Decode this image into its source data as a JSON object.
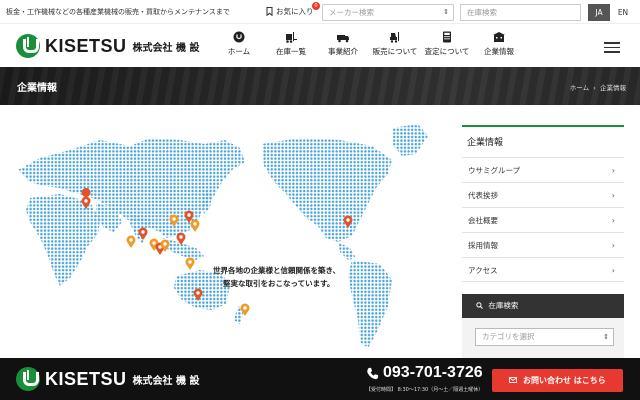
{
  "topbar": {
    "tagline": "板金・工作機械などの各種産業機械の販売・買取からメンテナンスまで",
    "favorites_label": "お気に入り",
    "favorites_count": "0",
    "maker_placeholder": "メーカー検索",
    "stock_placeholder": "在庫検索",
    "lang_ja": "JA",
    "lang_en": "EN"
  },
  "brand": {
    "name": "KISETSU",
    "sub": "株式会社 機 設",
    "color": "#1a8f3a"
  },
  "nav": [
    {
      "label": "ホーム",
      "icon": "home-logo-icon"
    },
    {
      "label": "在庫一覧",
      "icon": "forklift-icon"
    },
    {
      "label": "事業紹介",
      "icon": "truck-icon"
    },
    {
      "label": "販売について",
      "icon": "forklift-sale-icon"
    },
    {
      "label": "査定について",
      "icon": "calculator-icon"
    },
    {
      "label": "企業情報",
      "icon": "building-icon"
    }
  ],
  "banner": {
    "title": "企業情報",
    "breadcrumb_home": "ホーム",
    "breadcrumb_sep": "›",
    "breadcrumb_current": "企業情報"
  },
  "map": {
    "caption_line1": "世界各地の企業様と信頼関係を築き、",
    "caption_line2": "堅実な取引をおこなっています。",
    "dot_color": "#4aa3d8",
    "pin_red": "#e0542a",
    "pin_orange": "#f09a28"
  },
  "sidebar": {
    "title": "企業情報",
    "items": [
      {
        "label": "ウサミグループ"
      },
      {
        "label": "代表挨拶"
      },
      {
        "label": "会社概要"
      },
      {
        "label": "採用情報"
      },
      {
        "label": "アクセス"
      }
    ],
    "chevron": "›",
    "search_title": "在庫検索",
    "category_placeholder": "カテゴリを選択"
  },
  "footer": {
    "phone": "093-701-3726",
    "hours": "【受付時間】 8:30〜17:30（月〜土／隔週土曜休）",
    "contact_label": "お問い合わせ はこちら"
  }
}
